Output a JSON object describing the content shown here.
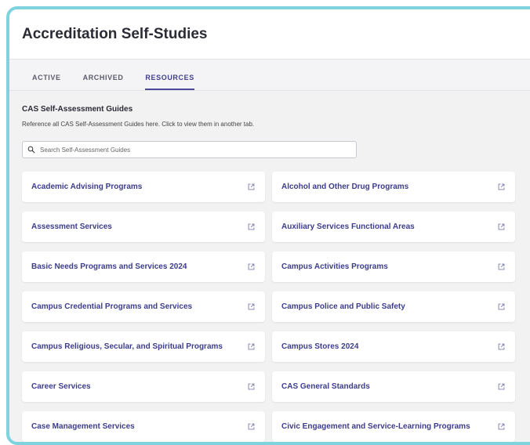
{
  "header": {
    "title": "Accreditation Self-Studies"
  },
  "tabs": [
    {
      "label": "ACTIVE",
      "active": false
    },
    {
      "label": "ARCHIVED",
      "active": false
    },
    {
      "label": "RESOURCES",
      "active": true
    }
  ],
  "resources": {
    "title": "CAS Self-Assessment Guides",
    "description": "Reference all CAS Self-Assessment Guides here. Click to view them in another tab.",
    "search_placeholder": "Search Self-Assessment Guides",
    "search_value": "",
    "guides": [
      {
        "label": "Academic Advising Programs",
        "icon": "external-link-icon"
      },
      {
        "label": "Alcohol and Other Drug Programs",
        "icon": "external-link-icon"
      },
      {
        "label": "Assessment Services",
        "icon": "external-link-icon"
      },
      {
        "label": "Auxiliary Services Functional Areas",
        "icon": "external-link-icon"
      },
      {
        "label": "Basic Needs Programs and Services 2024",
        "icon": "external-link-icon"
      },
      {
        "label": "Campus Activities Programs",
        "icon": "external-link-icon"
      },
      {
        "label": "Campus Credential Programs and Services",
        "icon": "external-link-icon"
      },
      {
        "label": "Campus Police and Public Safety",
        "icon": "external-link-icon"
      },
      {
        "label": "Campus Religious, Secular, and Spiritual Programs",
        "icon": "external-link-icon"
      },
      {
        "label": "Campus Stores 2024",
        "icon": "external-link-icon"
      },
      {
        "label": "Career Services",
        "icon": "external-link-icon"
      },
      {
        "label": "CAS General Standards",
        "icon": "external-link-icon"
      },
      {
        "label": "Case Management Services",
        "icon": "external-link-icon"
      },
      {
        "label": "Civic Engagement and Service-Learning Programs",
        "icon": "external-link-icon"
      }
    ]
  },
  "colors": {
    "frame_border": "#7fd3df",
    "accent": "#3c3c8c",
    "background": "#f2f2f3"
  }
}
